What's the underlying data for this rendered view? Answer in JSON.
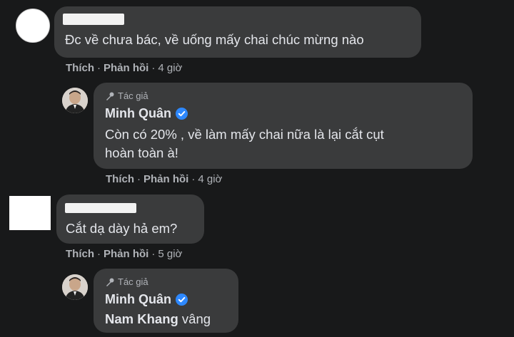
{
  "comments": [
    {
      "text": "Đc về chưa bác, về uống mấy chai chúc mừng nào",
      "actions": {
        "like": "Thích",
        "reply": "Phản hồi",
        "time": "4 giờ"
      }
    },
    {
      "author_tag": "Tác giả",
      "author": "Minh Quân",
      "text_line1": "Còn có 20% , về làm mấy chai nữa là lại cắt cụt",
      "text_line2": "hoàn toàn à!",
      "actions": {
        "like": "Thích",
        "reply": "Phản hồi",
        "time": "4 giờ"
      }
    },
    {
      "text": "Cắt dạ dày hả em?",
      "actions": {
        "like": "Thích",
        "reply": "Phản hồi",
        "time": "5 giờ"
      }
    },
    {
      "author_tag": "Tác giả",
      "author": "Minh Quân",
      "mention": "Nam Khang",
      "text": " vâng"
    }
  ],
  "separator": "·",
  "colors": {
    "background": "#18191a",
    "bubble": "#3a3b3c",
    "verified": "#2d88ff"
  }
}
